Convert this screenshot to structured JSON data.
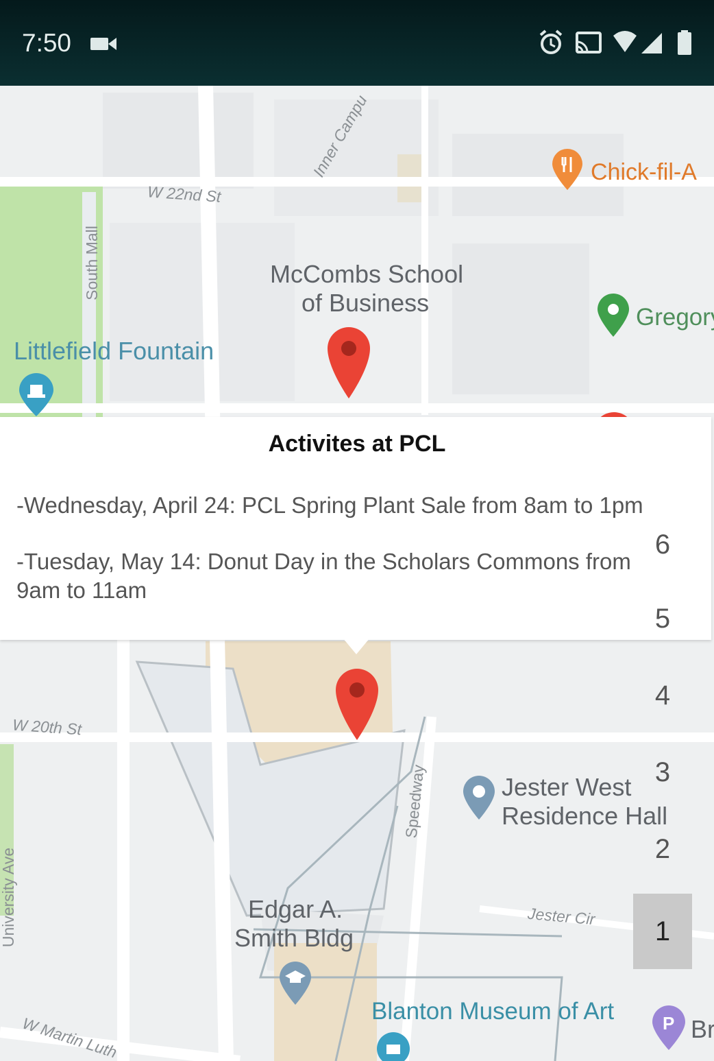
{
  "status_bar": {
    "time": "7:50",
    "icons": [
      "video-camera-icon",
      "alarm-icon",
      "cast-icon",
      "wifi-icon",
      "signal-icon",
      "battery-icon"
    ]
  },
  "map": {
    "road_labels": {
      "w22nd": "W 22nd St",
      "inner_campus": "Inner Campu",
      "south_mall": "South Mall",
      "w20th": "W 20th St",
      "speedway": "Speedway",
      "jester_cir": "Jester Cir",
      "university_ave": "University Ave",
      "w_martin": "W Martin Luth"
    },
    "pois": {
      "chick_fil_a": "Chick-fil-A",
      "mccombs_line1": "McCombs School",
      "mccombs_line2": "of Business",
      "gregory": "Gregory",
      "littlefield": "Littlefield Fountain",
      "jester_line1": "Jester West",
      "jester_line2": "Residence Hall",
      "edgar_line1": "Edgar A.",
      "edgar_line2": "Smith Bldg",
      "blanton": "Blanton Museum of Art",
      "br": "Br"
    },
    "colors": {
      "marker_red": "#ea4335",
      "restaurant_orange": "#f08c3a",
      "green_pin": "#3fa04b",
      "grey_pin": "#7b9bb5",
      "teal_pin": "#39a0c4",
      "parking_purple": "#9b86d6"
    }
  },
  "info_window": {
    "title": "Activites at PCL",
    "line1": "-Wednesday, April 24: PCL Spring Plant Sale from 8am to 1pm",
    "line2a": "-Tuesday, May 14: Donut Day in the Scholars Commons from",
    "line2b": "9am to 11am"
  },
  "floor_selector": {
    "floors": [
      "6",
      "5",
      "4",
      "3",
      "2",
      "1"
    ],
    "selected": "1"
  }
}
